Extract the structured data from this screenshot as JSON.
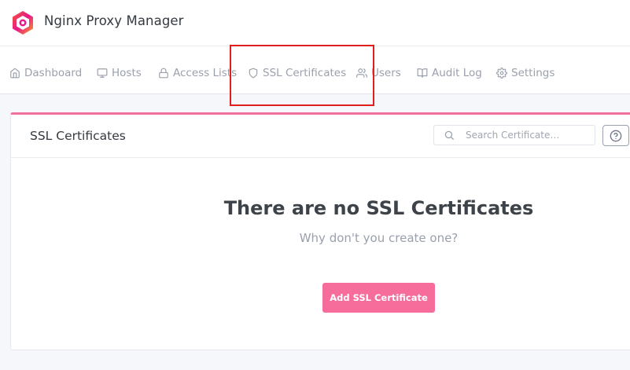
{
  "app": {
    "title": "Nginx Proxy Manager",
    "logo_icon": "nginx-proxy-manager-logo"
  },
  "nav": {
    "items": [
      {
        "label": "Dashboard",
        "icon": "home-icon"
      },
      {
        "label": "Hosts",
        "icon": "monitor-icon"
      },
      {
        "label": "Access Lists",
        "icon": "lock-icon"
      },
      {
        "label": "SSL Certificates",
        "icon": "shield-icon",
        "highlighted": true
      },
      {
        "label": "Users",
        "icon": "users-icon"
      },
      {
        "label": "Audit Log",
        "icon": "book-open-icon"
      },
      {
        "label": "Settings",
        "icon": "gear-icon"
      }
    ]
  },
  "card": {
    "title": "SSL Certificates",
    "search": {
      "placeholder": "Search Certificate…",
      "value": ""
    },
    "help_icon": "help-circle-icon",
    "empty": {
      "title": "There are no SSL Certificates",
      "subtitle": "Why don't you create one?",
      "button_label": "Add SSL Certificate"
    }
  },
  "colors": {
    "accent": "#f66d9b",
    "card_top_border": "#f06f9b",
    "nav_text": "#9aa0ac",
    "highlight": "#e01e1e"
  }
}
